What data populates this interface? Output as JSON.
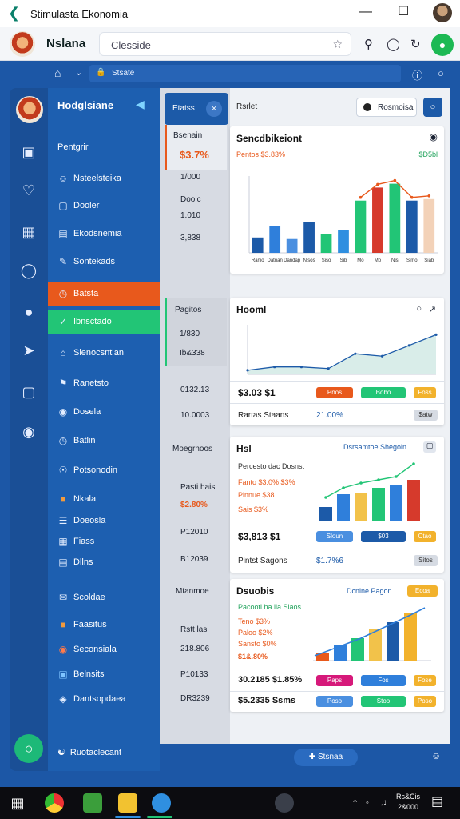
{
  "window": {
    "title": "Stimulasta Ekonomia",
    "back_icon": "arrow-left-icon"
  },
  "header": {
    "app_name": "Nslana",
    "search_placeholder": "Clesside",
    "star_icon": "star-icon"
  },
  "nav": {
    "url_text": "Stsate"
  },
  "sidebar": {
    "brand": "Hodglsiane",
    "section": "Pentgrir",
    "items": [
      {
        "label": "Nsteelsteika",
        "icon": "user-icon"
      },
      {
        "label": "Dooler",
        "icon": "card-icon"
      },
      {
        "label": "Ekodsnemia",
        "icon": "chart-icon"
      },
      {
        "label": "Sontekads",
        "icon": "pen-icon"
      },
      {
        "label": "Batsta",
        "icon": "clock-icon",
        "state": "orange"
      },
      {
        "label": "Ibnsctado",
        "icon": "check-icon",
        "state": "green"
      },
      {
        "label": "Slenocsntian",
        "icon": "house-icon"
      },
      {
        "label": "Ranetsto",
        "icon": "cart-icon"
      },
      {
        "label": "Dosela",
        "icon": "gift-icon"
      },
      {
        "label": "Batlin",
        "icon": "clock-icon"
      },
      {
        "label": "Potsonodin",
        "icon": "globe-icon"
      },
      {
        "label": "Nkala",
        "icon": "folder-icon"
      },
      {
        "label": "Doeosla",
        "icon": "list-icon"
      },
      {
        "label": "Fiass",
        "icon": "grid-icon"
      },
      {
        "label": "Dllns",
        "icon": "image-icon"
      },
      {
        "label": "Scoldae",
        "icon": "mail-icon"
      },
      {
        "label": "Faasitus",
        "icon": "folder-icon"
      },
      {
        "label": "Seconsiala",
        "icon": "target-icon"
      },
      {
        "label": "Belnsits",
        "icon": "note-icon"
      },
      {
        "label": "Dantsopdaea",
        "icon": "shield-icon"
      }
    ],
    "footer": "Ruotaclecant"
  },
  "summary": {
    "tab": "Etatss",
    "card1": {
      "title": "Bsenain",
      "value": "$3.7%"
    },
    "v1": "1/000",
    "v2": "Doolc",
    "v3": "1.010",
    "v4": "3,838",
    "card2": {
      "title": "Pagitos",
      "value": "1/830"
    },
    "v5": "Ib&338",
    "v6": "0132.13",
    "v7": "10.0003",
    "label3": "Moegrnoos",
    "v8": "Pasti hais",
    "v9": "$2.80%",
    "v10": "P12010",
    "v11": "B12039",
    "label4": "Mtanmoe",
    "v12": "Rstt las",
    "v13": "218.806",
    "v14": "P10133",
    "v15": "DR3239"
  },
  "main": {
    "toplabel": "Rsrlet",
    "topbtn": "Rosmoisa",
    "cards": [
      {
        "title": "Sencdbikeiont",
        "meta": "Pentos $3.83%",
        "meta2": "$D5bl",
        "chart": "bar"
      },
      {
        "title": "Hooml",
        "value": "$3.03 $1",
        "pills": [
          "Pnos",
          "Bobo",
          "Foss"
        ],
        "label": "Rartas Staans",
        "pct": "21.00%",
        "btn": "$atw",
        "chart": "line"
      },
      {
        "title": "Hsl",
        "subtitle": "Dsrsamtoe Shegoin",
        "desc": "Percesto dac Dosnst",
        "row1": "Fanto $3.0% $3%",
        "row2": "Pinnue $38",
        "row3": "Sais $3%",
        "value": "$3,813 $1",
        "pills": [
          "Sloun",
          "$03",
          "Ctao"
        ],
        "label": "Pintst Sagons",
        "pct": "$1.7%6",
        "btn": "Sitos",
        "chart": "combo"
      },
      {
        "title": "Dsuobis",
        "subtitle": "Dcnine Pagon",
        "btn_top": "Ecoa",
        "rows": [
          "Pacooti ha lia Siaos",
          "Teno $3%",
          "Paloo $2%",
          "Sansto $0%"
        ],
        "highlight": "$1&.80%",
        "value": "30.2185 $1.85%",
        "value2": "$5.2335 Ssms",
        "pills": [
          "Paps",
          "Fos",
          "Fose"
        ],
        "pills2": [
          "Poso",
          "Stoo",
          "Poso"
        ],
        "chart": "bar2"
      }
    ]
  },
  "bottom": {
    "button": "Stsnaa"
  },
  "taskbar": {
    "time": "Rs&Cis",
    "date": "2&000"
  },
  "chart_data": [
    {
      "type": "bar",
      "categories": [
        "Ranio",
        "Datnan",
        "Dandap",
        "Nisos",
        "Siso",
        "Sib",
        "Mo",
        "Mo",
        "Nis",
        "Simo",
        "Siab"
      ],
      "series": [
        {
          "values": [
            2,
            3.5,
            1.8,
            4,
            2.5,
            3,
            6.8,
            8.5,
            9,
            6.8,
            7
          ]
        }
      ],
      "ylim": [
        0,
        10
      ],
      "title": "Sencdbikeiont"
    },
    {
      "type": "line",
      "series": [
        {
          "values": [
            0.5,
            0.9,
            0.9,
            0.7,
            2.5,
            2.2,
            3.5,
            4.8
          ]
        }
      ],
      "ylim": [
        0,
        6
      ],
      "title": "Hooml"
    }
  ]
}
